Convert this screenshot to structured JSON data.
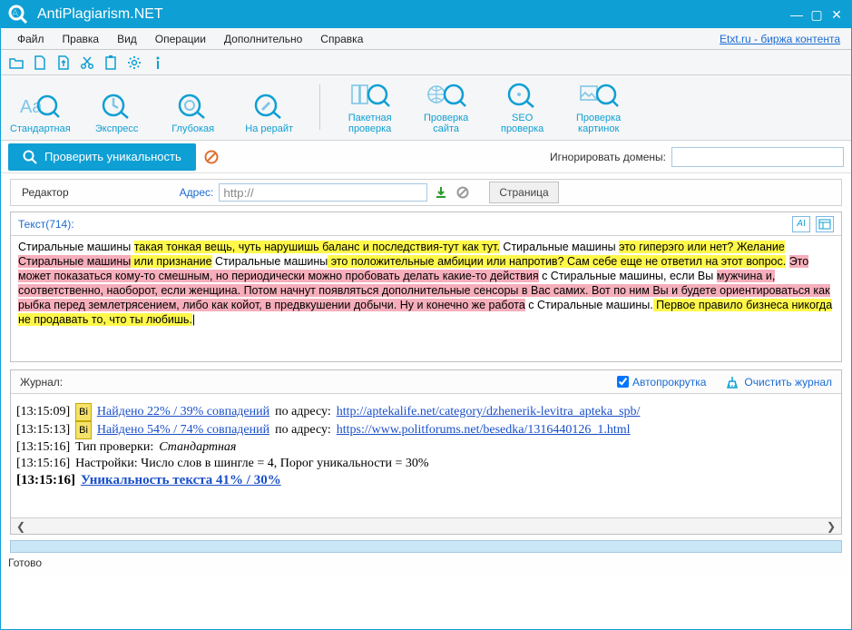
{
  "window": {
    "title": "AntiPlagiarism.NET"
  },
  "menubar": [
    "Файл",
    "Правка",
    "Вид",
    "Операции",
    "Дополнительно",
    "Справка"
  ],
  "menubar_link": "Etxt.ru - биржа контента",
  "big_buttons_a": [
    {
      "label": "Стандартная"
    },
    {
      "label": "Экспресс"
    },
    {
      "label": "Глубокая"
    },
    {
      "label": "На рерайт"
    }
  ],
  "big_buttons_b": [
    {
      "label": "Пакетная\nпроверка"
    },
    {
      "label": "Проверка\nсайта"
    },
    {
      "label": "SEO\nпроверка"
    },
    {
      "label": "Проверка\nкартинок"
    }
  ],
  "check_button": "Проверить уникальность",
  "ignore_label": "Игнорировать домены:",
  "ignore_value": "",
  "editor_tab": "Редактор",
  "address_label": "Адрес:",
  "address_value": "http://",
  "page_tab": "Страница",
  "text_counter": "Текст(714):",
  "segments": [
    {
      "t": "Стиральные машины ",
      "c": ""
    },
    {
      "t": "такая тонкая вещь, чуть нарушишь баланс и последствия-тут как тут.",
      "c": "hl-y"
    },
    {
      "t": " Стиральные машины ",
      "c": ""
    },
    {
      "t": "это гиперэго или нет? Желание",
      "c": "hl-y"
    },
    {
      "t": " ",
      "c": ""
    },
    {
      "t": "Стиральные машины",
      "c": "hl-p"
    },
    {
      "t": " или признание",
      "c": "hl-y"
    },
    {
      "t": " Стиральные машины",
      "c": ""
    },
    {
      "t": " это положительные амбиции или напротив? Сам себе еще не ответил на этот вопрос.",
      "c": "hl-y"
    },
    {
      "t": " ",
      "c": ""
    },
    {
      "t": "Это может показаться кому-то смешным, но периодически можно пробовать делать какие-то действия",
      "c": "hl-p"
    },
    {
      "t": " с Стиральные машины, если Вы ",
      "c": ""
    },
    {
      "t": "мужчина и, соответственно, наоборот, если женщина. Потом начнут появляться дополнительные сенсоры в Вас самих. Вот по ним Вы и будете ориентироваться как рыбка перед землетрясением, либо как койот, в предвкушении добычи. Ну и конечно же работа",
      "c": "hl-p"
    },
    {
      "t": " с Стиральные машины.",
      "c": ""
    },
    {
      "t": " Первое правило бизнеса никогда не продавать то, что ты любишь.",
      "c": "hl-y"
    }
  ],
  "journal_title": "Журнал:",
  "autoscroll": "Автопрокрутка",
  "clear_journal": "Очистить журнал",
  "journal": [
    {
      "ts": "[13:15:09]",
      "badge": "Bi",
      "link": "Найдено 22% / 39% совпадений",
      "mid": " по адресу: ",
      "url": "http://aptekalife.net/category/dzhenerik-levitra_apteka_spb/"
    },
    {
      "ts": "[13:15:13]",
      "badge": "Bi",
      "link": "Найдено 54% / 74% совпадений",
      "mid": " по адресу: ",
      "url": "https://www.politforums.net/besedka/1316440126_1.html"
    },
    {
      "ts": "[13:15:16]",
      "plain_a": "Тип проверки: ",
      "plain_i": "Стандартная"
    },
    {
      "ts": "[13:15:16]",
      "plain_a": "Настройки: Число слов в шингле = 4, Порог уникальности = 30%"
    },
    {
      "ts": "[13:15:16]",
      "bold_link": "Уникальность текста 41% / 30%"
    }
  ],
  "status": "Готово"
}
